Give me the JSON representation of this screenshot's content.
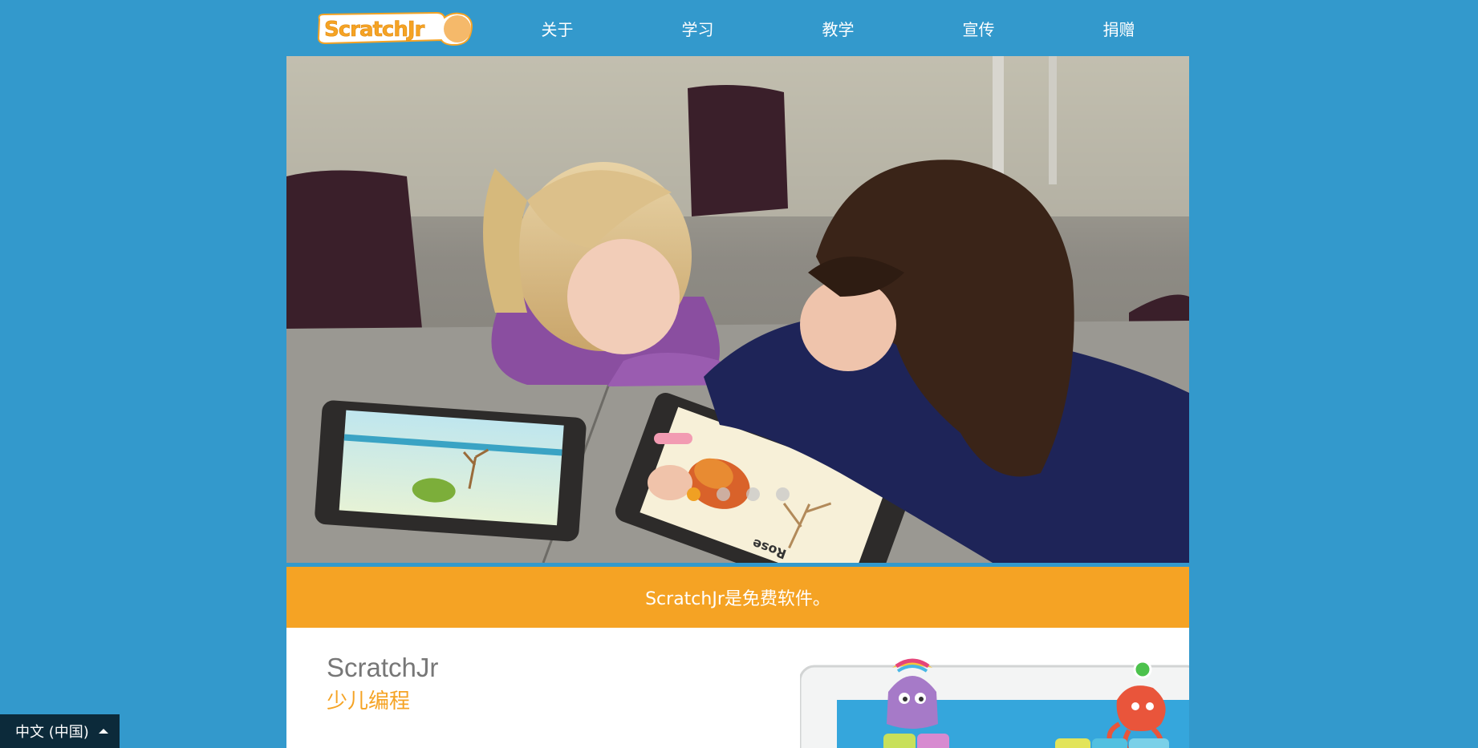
{
  "header": {
    "logo_text": "ScratchJr",
    "nav": [
      {
        "label": "关于"
      },
      {
        "label": "学习"
      },
      {
        "label": "教学"
      },
      {
        "label": "宣传"
      },
      {
        "label": "捐赠"
      }
    ]
  },
  "hero": {
    "slides_count": 4,
    "active_slide": 1,
    "tablet_label": "Rose"
  },
  "banner": {
    "text": "ScratchJr是免费软件。"
  },
  "product": {
    "title": "ScratchJr",
    "subtitle": "少儿编程"
  },
  "language_selector": {
    "value": "中文 (中国)"
  },
  "colors": {
    "background": "#3399cc",
    "accent_orange": "#f5a324",
    "active_dot": "#f0a023",
    "lang_bar": "#0c2a3a"
  }
}
